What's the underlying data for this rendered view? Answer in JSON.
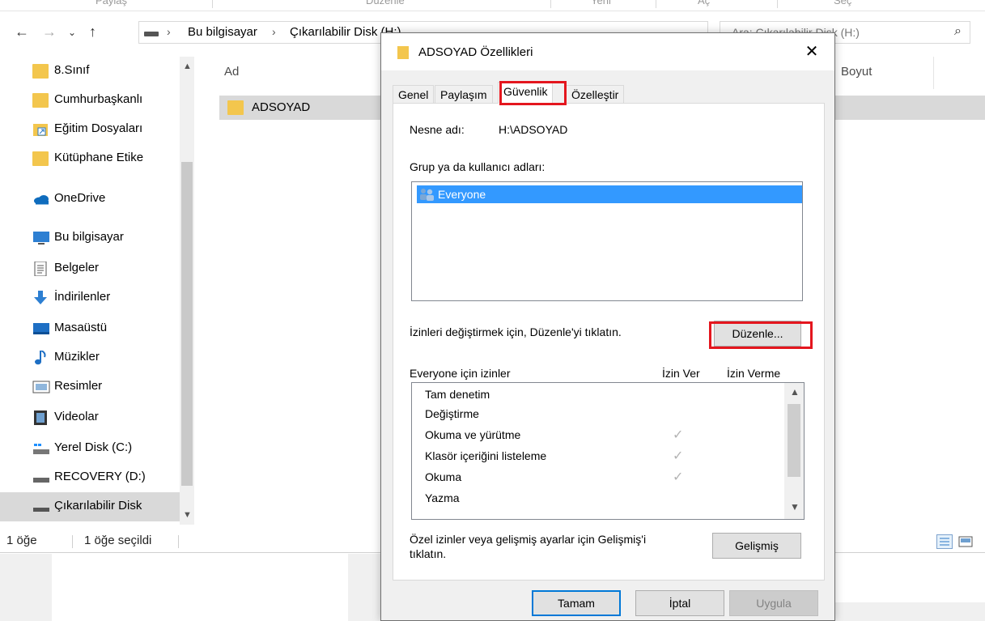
{
  "ribbon": {
    "tabs": [
      "Paylaş",
      "Düzenle",
      "Yeni",
      "Aç",
      "Seç"
    ]
  },
  "address": {
    "crumbs": [
      "Bu bilgisayar",
      "Çıkarılabilir Disk (H:)"
    ],
    "search_placeholder": "Ara: Çıkarılabilir Disk (H:)"
  },
  "nav": {
    "items": [
      {
        "label": "8.Sınıf",
        "icon": "folder-icon"
      },
      {
        "label": "Cumhurbaşkanlı",
        "icon": "folder-icon"
      },
      {
        "label": "Eğitim Dosyaları",
        "icon": "shortcut-folder-icon"
      },
      {
        "label": "Kütüphane Etike",
        "icon": "folder-icon"
      },
      {
        "label": "OneDrive",
        "icon": "cloud-icon"
      },
      {
        "label": "Bu bilgisayar",
        "icon": "computer-icon"
      },
      {
        "label": "Belgeler",
        "icon": "document-icon"
      },
      {
        "label": "İndirilenler",
        "icon": "download-icon"
      },
      {
        "label": "Masaüstü",
        "icon": "desktop-icon"
      },
      {
        "label": "Müzikler",
        "icon": "music-icon"
      },
      {
        "label": "Resimler",
        "icon": "pictures-icon"
      },
      {
        "label": "Videolar",
        "icon": "video-icon"
      },
      {
        "label": "Yerel Disk (C:)",
        "icon": "local-disk-icon"
      },
      {
        "label": "RECOVERY (D:)",
        "icon": "drive-icon"
      },
      {
        "label": "Çıkarılabilir Disk",
        "icon": "removable-drive-icon"
      }
    ]
  },
  "content": {
    "columns": [
      "Ad",
      "Boyut"
    ],
    "files": [
      {
        "name": "ADSOYAD"
      }
    ]
  },
  "status": {
    "count": "1 öğe",
    "selected": "1 öğe seçildi"
  },
  "dialog": {
    "title": "ADSOYAD Özellikleri",
    "close": "✕",
    "tabs": [
      "Genel",
      "Paylaşım",
      "Güvenlik",
      "Özelleştir"
    ],
    "active_tab": "Güvenlik",
    "object_label": "Nesne adı:",
    "object_value": "H:\\ADSOYAD",
    "group_label": "Grup ya da kullanıcı adları:",
    "users": [
      "Everyone"
    ],
    "edit_hint": "İzinleri değiştirmek için, Düzenle'yi tıklatın.",
    "edit_button": "Düzenle...",
    "perm_header": "Everyone için izinler",
    "allow_col": "İzin Ver",
    "deny_col": "İzin Verme",
    "permissions": [
      {
        "name": "Tam denetim",
        "allow": false
      },
      {
        "name": "Değiştirme",
        "allow": false
      },
      {
        "name": "Okuma ve yürütme",
        "allow": true
      },
      {
        "name": "Klasör içeriğini listeleme",
        "allow": true
      },
      {
        "name": "Okuma",
        "allow": true
      },
      {
        "name": "Yazma",
        "allow": false
      }
    ],
    "check_glyph": "✓",
    "advanced_hint_1": "Özel izinler veya gelişmiş ayarlar için Gelişmiş'i",
    "advanced_hint_2": "tıklatın.",
    "advanced_button": "Gelişmiş",
    "ok": "Tamam",
    "cancel": "İptal",
    "apply": "Uygula"
  },
  "colors": {
    "highlight": "#e4161e",
    "selection": "#3399ff",
    "folder": "#f3c64d"
  }
}
